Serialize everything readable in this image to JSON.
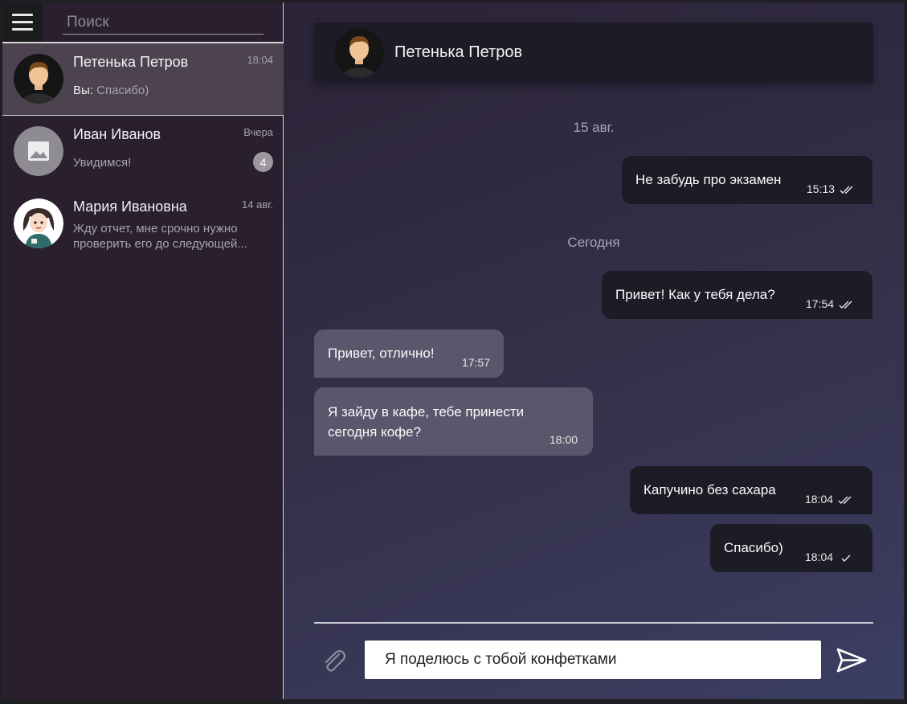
{
  "sidebar": {
    "search_placeholder": "Поиск",
    "chats": [
      {
        "name": "Петенька Петров",
        "time": "18:04",
        "prefix": "Вы:",
        "preview": "Спасибо)",
        "active": true
      },
      {
        "name": "Иван Иванов",
        "time": "Вчера",
        "preview": "Увидимся!",
        "unread": "4"
      },
      {
        "name": "Мария Ивановна",
        "time": "14 авг.",
        "preview_line1": "Жду отчет, мне срочно нужно",
        "preview_line2": "проверить его до следующей..."
      }
    ]
  },
  "chat": {
    "title": "Петенька Петров",
    "dates": [
      "15 авг.",
      "Сегодня"
    ],
    "messages": [
      {
        "dir": "out",
        "text": "Не забудь про экзамен",
        "time": "15:13",
        "status": "read"
      },
      {
        "dir": "out",
        "text": "Привет! Как у тебя дела?",
        "time": "17:54",
        "status": "read"
      },
      {
        "dir": "in",
        "text": "Привет, отлично!",
        "time": "17:57"
      },
      {
        "dir": "in",
        "text_line1": "Я зайду в кафе, тебе принести",
        "text_line2": "сегодня кофе?",
        "time": "18:00"
      },
      {
        "dir": "out",
        "text": "Капучино без сахара",
        "time": "18:04",
        "status": "read"
      },
      {
        "dir": "out",
        "text": "Спасибо)",
        "time": "18:04",
        "status": "sent"
      }
    ],
    "composer_value": "Я поделюсь с тобой конфетками"
  },
  "icons": {
    "menu": "hamburger-icon",
    "attach": "paperclip-icon",
    "send": "send-icon",
    "read": "double-check-icon",
    "sent": "check-icon"
  }
}
